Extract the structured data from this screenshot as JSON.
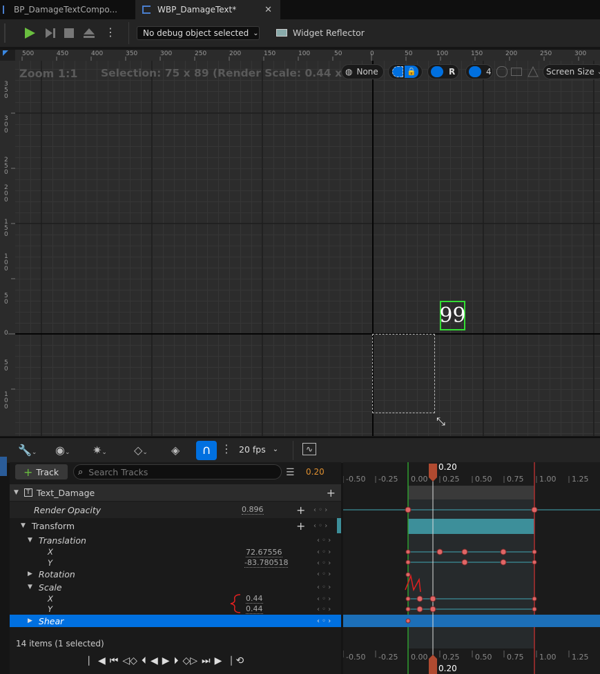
{
  "tabs": [
    {
      "label": "BP_DamageTextCompo..."
    },
    {
      "label": "WBP_DamageText*",
      "active": true
    }
  ],
  "toolbar": {
    "debug_select": "No debug object selected",
    "widget_reflector": "Widget Reflector"
  },
  "designer": {
    "zoom_label": "Zoom 1:1",
    "selection_label": "Selection: 75 x 89 (Render Scale: 0.44 x 0.44)",
    "none_label": "None",
    "r_label": "R",
    "grid_value": "4",
    "screen_size_label": "Screen Size",
    "widget_text": "99",
    "ruler_top_ticks": [
      "500",
      "450",
      "400",
      "350",
      "300",
      "250",
      "200",
      "150",
      "100",
      "50",
      "0",
      "50",
      "100",
      "150",
      "200",
      "250",
      "300"
    ],
    "ruler_left_ticks": [
      "350",
      "300",
      "250",
      "200",
      "150",
      "100",
      "50",
      "0",
      "50",
      "100"
    ]
  },
  "sequencer": {
    "fps_label": "20 fps",
    "track_button": "Track",
    "search_placeholder": "Search Tracks",
    "current_time": "0.20",
    "playhead_label_top": "0.20",
    "playhead_label_bottom": "0.20",
    "timeline_ticks": [
      "-0.50",
      "-0.25",
      "0.00",
      "0.25",
      "0.50",
      "0.75",
      "1.00",
      "1.25"
    ],
    "tracks": {
      "text_damage": "Text_Damage",
      "render_opacity": "Render Opacity",
      "render_opacity_value": "0.896",
      "transform": "Transform",
      "translation": "Translation",
      "translation_x": "X",
      "translation_x_value": "72.67556",
      "translation_y": "Y",
      "translation_y_value": "-83.780518",
      "rotation": "Rotation",
      "scale": "Scale",
      "scale_x": "X",
      "scale_x_value": "0.44",
      "scale_y": "Y",
      "scale_y_value": "0.44",
      "shear": "Shear"
    },
    "items_status": "14 items (1 selected)"
  },
  "colors": {
    "accent": "#0070e0",
    "teal": "#3d8f9a",
    "key": "#e06666"
  }
}
